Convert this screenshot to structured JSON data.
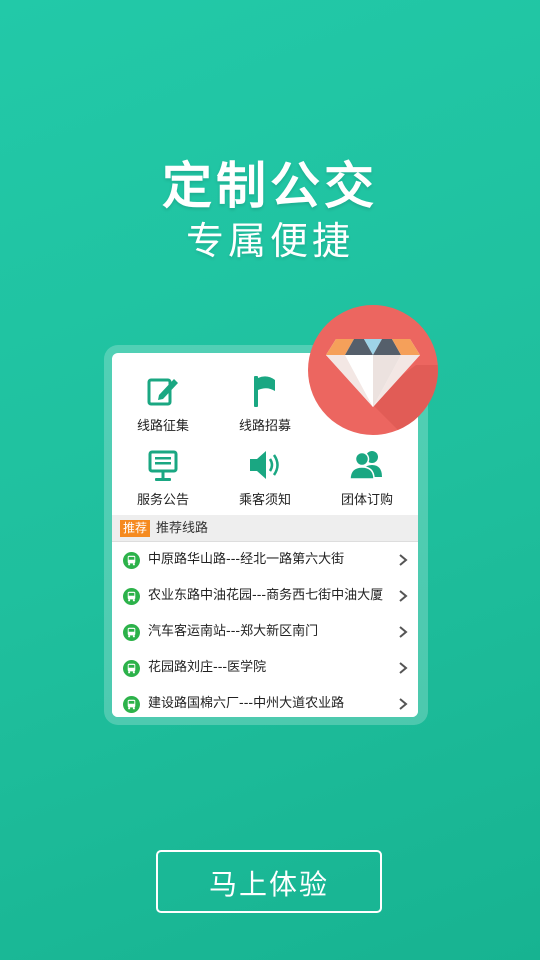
{
  "hero": {
    "title": "定制公交",
    "subtitle": "专属便捷"
  },
  "features": [
    {
      "label": "线路征集",
      "icon": "edit-icon"
    },
    {
      "label": "线路招募",
      "icon": "flag-icon"
    },
    {
      "label": "服务公告",
      "icon": "notice-board-icon"
    },
    {
      "label": "乘客须知",
      "icon": "speaker-icon"
    },
    {
      "label": "团体订购",
      "icon": "group-icon"
    }
  ],
  "recommended": {
    "badge": "推荐",
    "title": "推荐线路",
    "routes": [
      "中原路华山路---经北一路第六大街",
      "农业东路中油花园---商务西七街中油大厦",
      "汽车客运南站---郑大新区南门",
      "花园路刘庄---医学院",
      "建设路国棉六厂---中州大道农业路"
    ]
  },
  "cta": {
    "label": "马上体验"
  },
  "colors": {
    "background": "#1fbf9d",
    "icon_green": "#1aa782",
    "bus_green": "#2cb24a",
    "badge_orange": "#f58a1f",
    "diamond_red": "#ec6660"
  }
}
